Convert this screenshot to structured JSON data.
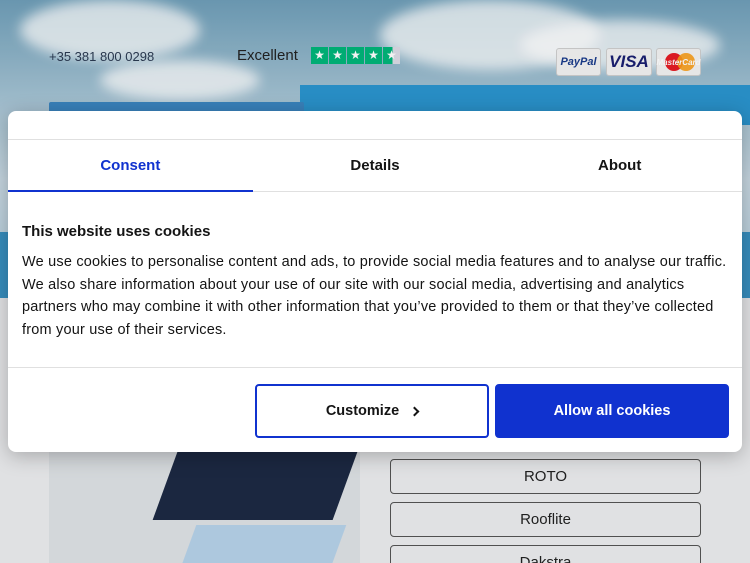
{
  "header": {
    "phone": "+35 381 800 0298",
    "trustpilot_label": "Excellent",
    "payments": [
      "PayPal",
      "VISA",
      "MasterCard"
    ]
  },
  "brands": [
    "ROTO",
    "Rooflite",
    "Dakstra"
  ],
  "cookie_dialog": {
    "tabs": [
      "Consent",
      "Details",
      "About"
    ],
    "active_tab": "Consent",
    "title": "This website uses cookies",
    "body": "We use cookies to personalise content and ads, to provide social media features and to analyse our traffic. We also share information about your use of our site with our social media, advertising and analytics partners who may combine it with other information that you’ve provided to them or that they’ve collected from your use of their services.",
    "customize_label": "Customize",
    "allow_label": "Allow all cookies"
  },
  "colors": {
    "accent": "#1032cf",
    "trust_green": "#00b67a",
    "site_blue": "#2b95cf"
  }
}
